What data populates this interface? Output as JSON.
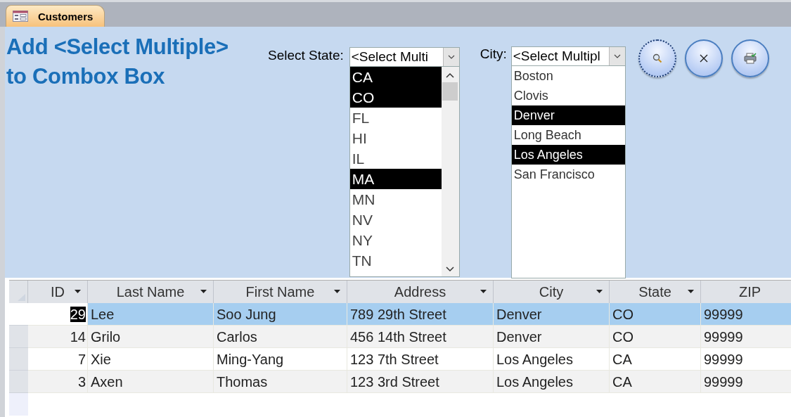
{
  "tab": {
    "label": "Customers"
  },
  "form": {
    "title": "Add <Select Multiple> to Combox Box",
    "state_filter": {
      "label": "Select State:",
      "combo_value": "<Select Multi",
      "items": [
        {
          "text": "CA",
          "selected": true
        },
        {
          "text": "CO",
          "selected": true
        },
        {
          "text": "FL",
          "selected": false
        },
        {
          "text": "HI",
          "selected": false
        },
        {
          "text": "IL",
          "selected": false
        },
        {
          "text": "MA",
          "selected": true
        },
        {
          "text": "MN",
          "selected": false
        },
        {
          "text": "NV",
          "selected": false
        },
        {
          "text": "NY",
          "selected": false
        },
        {
          "text": "TN",
          "selected": false
        }
      ]
    },
    "city_filter": {
      "label": "City:",
      "combo_value": "<Select Multipl",
      "items": [
        {
          "text": "Boston",
          "selected": false
        },
        {
          "text": "Clovis",
          "selected": false
        },
        {
          "text": "Denver",
          "selected": true
        },
        {
          "text": "Long Beach",
          "selected": false
        },
        {
          "text": "Los Angeles",
          "selected": true
        },
        {
          "text": "San Francisco",
          "selected": false
        }
      ]
    },
    "buttons": [
      {
        "kind": "search",
        "focused": true
      },
      {
        "kind": "clear",
        "focused": false
      },
      {
        "kind": "print",
        "focused": false
      }
    ]
  },
  "table": {
    "columns": [
      {
        "label": "ID",
        "filter": true
      },
      {
        "label": "Last Name",
        "filter": true
      },
      {
        "label": "First Name",
        "filter": true
      },
      {
        "label": "Address",
        "filter": true
      },
      {
        "label": "City",
        "filter": true
      },
      {
        "label": "State",
        "filter": true
      },
      {
        "label": "ZIP",
        "filter": false
      }
    ],
    "rows": [
      {
        "selected": true,
        "cells": [
          "29",
          "Lee",
          "Soo Jung",
          "789 29th Street",
          "Denver",
          "CO",
          "99999"
        ]
      },
      {
        "selected": false,
        "cells": [
          "14",
          "Grilo",
          "Carlos",
          "456 14th Street",
          "Denver",
          "CO",
          "99999"
        ]
      },
      {
        "selected": false,
        "cells": [
          "7",
          "Xie",
          "Ming-Yang",
          "123 7th Street",
          "Los Angeles",
          "CA",
          "99999"
        ]
      },
      {
        "selected": false,
        "cells": [
          "3",
          "Axen",
          "Thomas",
          "123 3rd Street",
          "Los Angeles",
          "CA",
          "99999"
        ]
      }
    ]
  }
}
